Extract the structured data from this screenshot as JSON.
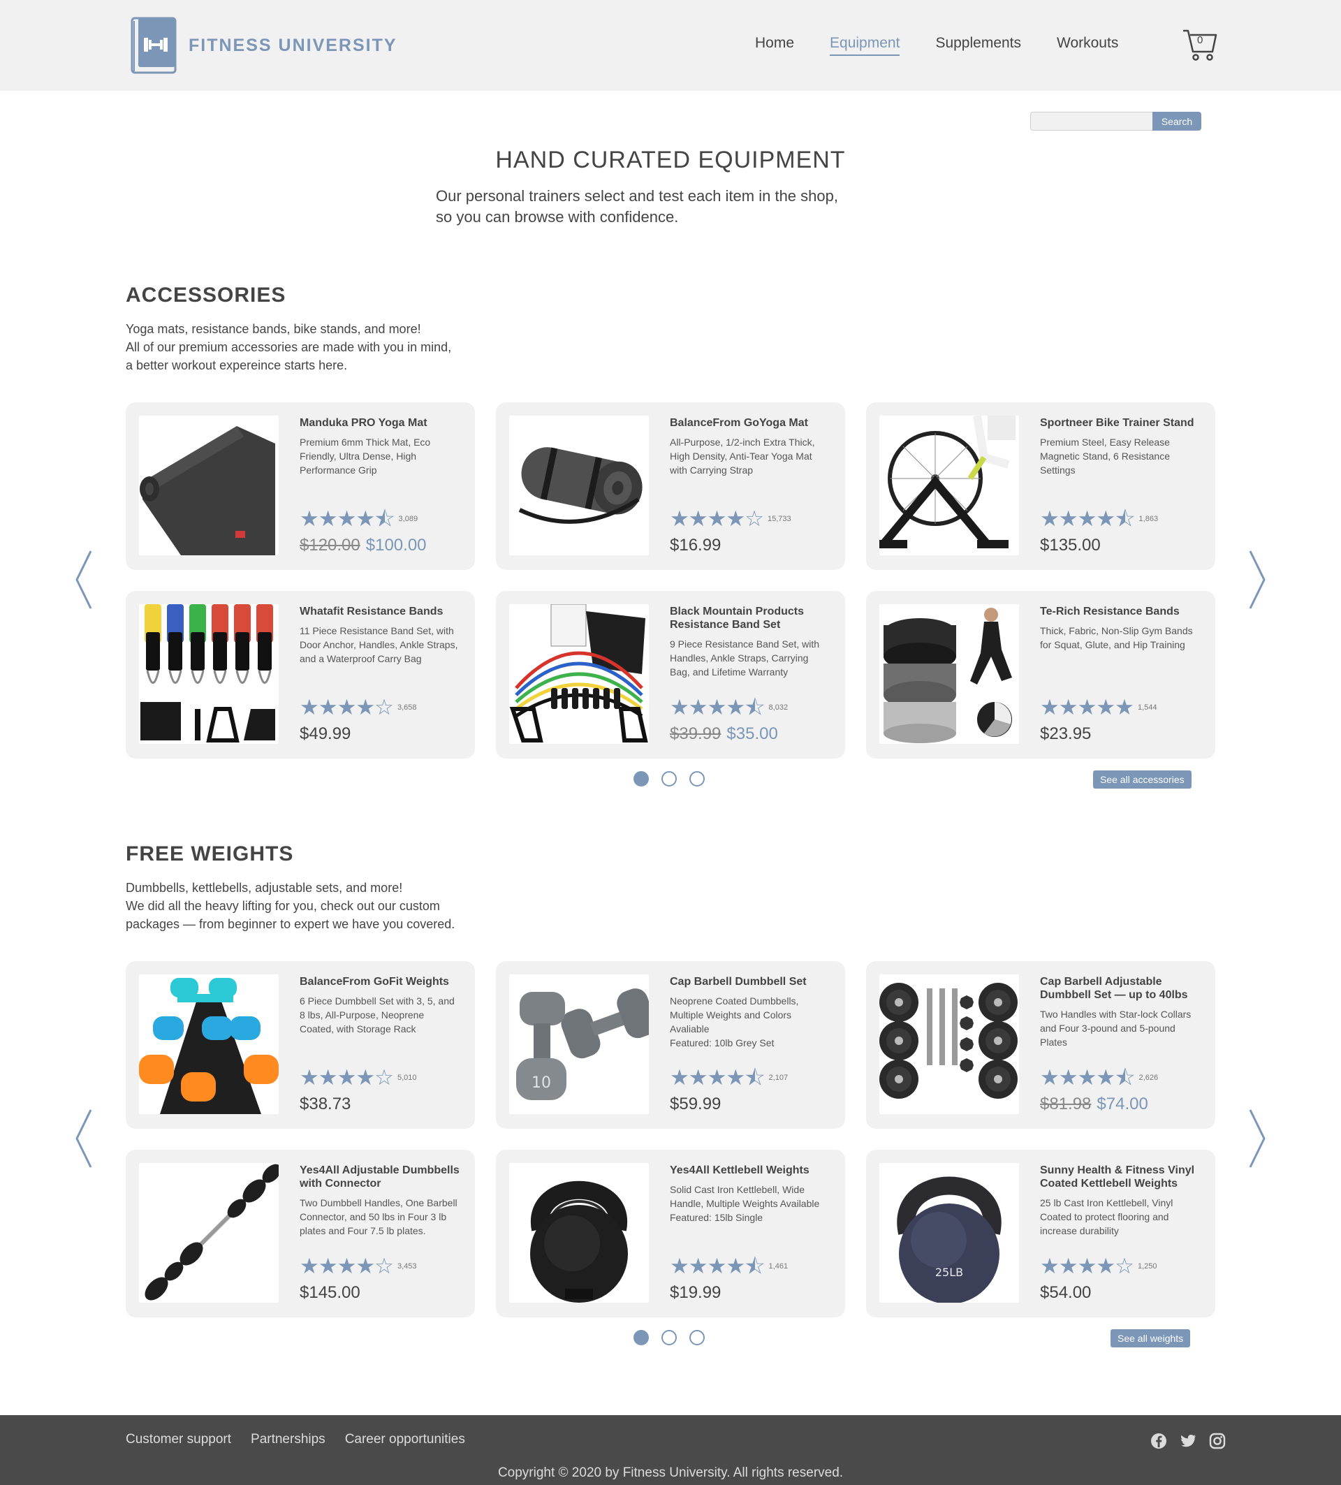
{
  "brand": {
    "name": "FITNESS UNIVERSITY",
    "accent_color": "#7b96b6"
  },
  "nav": {
    "items": [
      {
        "label": "Home",
        "active": false
      },
      {
        "label": "Equipment",
        "active": true
      },
      {
        "label": "Supplements",
        "active": false
      },
      {
        "label": "Workouts",
        "active": false
      }
    ],
    "cart_count": "0"
  },
  "search": {
    "placeholder": "",
    "button_label": "Search"
  },
  "intro": {
    "title": "HAND CURATED EQUIPMENT",
    "subtitle_line1": "Our personal trainers select and test each item in the shop,",
    "subtitle_line2": "so you can browse with confidence."
  },
  "accessories": {
    "title": "ACCESSORIES",
    "desc_line1": "Yoga mats, resistance bands, bike stands, and more!",
    "desc_line2": "All of our premium accessories are made with you in mind,",
    "desc_line3": "a better workout expereince starts here.",
    "see_all_label": "See all accessories",
    "products": [
      {
        "title": "Manduka PRO Yoga Mat",
        "desc": "Premium 6mm Thick Mat, Eco Friendly, Ultra Dense, High Performance Grip",
        "stars": "★★★★⯪",
        "rating_count": "3,089",
        "old_price": "$120.00",
        "price": "$100.00",
        "image": "yoga-mat-roll"
      },
      {
        "title": "BalanceFrom GoYoga Mat",
        "desc": "All-Purpose, 1/2-inch Extra Thick, High Density, Anti-Tear Yoga Mat with Carrying Strap",
        "stars": "★★★★☆",
        "rating_count": "15,733",
        "old_price": "",
        "price": "$16.99",
        "image": "yoga-mat-strap"
      },
      {
        "title": "Sportneer Bike Trainer Stand",
        "desc": "Premium Steel, Easy Release Magnetic Stand, 6 Resistance Settings",
        "stars": "★★★★⯪",
        "rating_count": "1,863",
        "old_price": "",
        "price": "$135.00",
        "image": "bike-stand"
      },
      {
        "title": "Whatafit Resistance Bands",
        "desc": "11 Piece Resistance Band Set, with Door Anchor, Handles, Ankle Straps, and a Waterproof Carry Bag",
        "stars": "★★★★☆",
        "rating_count": "3,658",
        "old_price": "",
        "price": "$49.99",
        "image": "bands-set"
      },
      {
        "title": "Black Mountain Products Resistance Band Set",
        "desc": "9 Piece Resistance Band Set, with Handles, Ankle Straps, Carrying Bag, and Lifetime Warranty",
        "stars": "★★★★⯪",
        "rating_count": "8,032",
        "old_price": "$39.99",
        "price": "$35.00",
        "image": "bands-tubes"
      },
      {
        "title": "Te-Rich Resistance Bands",
        "desc": "Thick, Fabric, Non-Slip Gym Bands for Squat, Glute, and Hip Training",
        "stars": "★★★★★",
        "rating_count": "1,544",
        "old_price": "",
        "price": "$23.95",
        "image": "fabric-bands"
      }
    ]
  },
  "weights": {
    "title": "FREE WEIGHTS",
    "desc_line1": "Dumbbells, kettlebells, adjustable sets, and more!",
    "desc_line2": "We did all the heavy lifting for you, check out our custom",
    "desc_line3": "packages — from beginner to expert we have you covered.",
    "see_all_label": "See all weights",
    "products": [
      {
        "title": "BalanceFrom GoFit Weights",
        "desc": "6 Piece Dumbbell Set with 3, 5, and 8 lbs, All-Purpose, Neoprene Coated, with Storage Rack",
        "stars": "★★★★☆",
        "rating_count": "5,010",
        "old_price": "",
        "price": "$38.73",
        "image": "dumbbell-rack"
      },
      {
        "title": "Cap Barbell Dumbbell Set",
        "desc": "Neoprene Coated Dumbbells, Multiple Weights and Colors Avaliable\nFeatured: 10lb Grey Set",
        "stars": "★★★★⯪",
        "rating_count": "2,107",
        "old_price": "",
        "price": "$59.99",
        "image": "grey-dumbbells"
      },
      {
        "title": "Cap Barbell Adjustable Dumbbell Set — up to 40lbs",
        "desc": "Two Handles with Star-lock Collars and Four 3-pound and 5-pound Plates",
        "stars": "★★★★⯪",
        "rating_count": "2,626",
        "old_price": "$81.98",
        "price": "$74.00",
        "image": "plates-set"
      },
      {
        "title": "Yes4All Adjustable Dumbbells with Connector",
        "desc": "Two Dumbbell Handles, One Barbell Connector, and 50 lbs in Four 3 lb plates and Four 7.5 lb plates.",
        "stars": "★★★★☆",
        "rating_count": "3,453",
        "old_price": "",
        "price": "$145.00",
        "image": "barbell"
      },
      {
        "title": "Yes4All Kettlebell Weights",
        "desc": "Solid Cast Iron Kettlebell, Wide Handle, Multiple Weights Available\nFeatured: 15lb Single",
        "stars": "★★★★⯪",
        "rating_count": "1,461",
        "old_price": "",
        "price": "$19.99",
        "image": "kettlebell-black"
      },
      {
        "title": "Sunny Health & Fitness Vinyl Coated Kettlebell Weights",
        "desc": "25 lb Cast Iron Kettlebell, Vinyl Coated to protect flooring and increase durability",
        "stars": "★★★★☆",
        "rating_count": "1,250",
        "old_price": "",
        "price": "$54.00",
        "image": "kettlebell-navy",
        "image_text": "25LB"
      }
    ],
    "image_labels": {
      "grey_dumbbell": "10"
    }
  },
  "footer": {
    "links": [
      "Customer support",
      "Partnerships",
      "Career opportunities"
    ],
    "copyright": "Copyright © 2020 by Fitness University. All rights reserved.",
    "socials": [
      "facebook-icon",
      "twitter-icon",
      "instagram-icon"
    ]
  }
}
